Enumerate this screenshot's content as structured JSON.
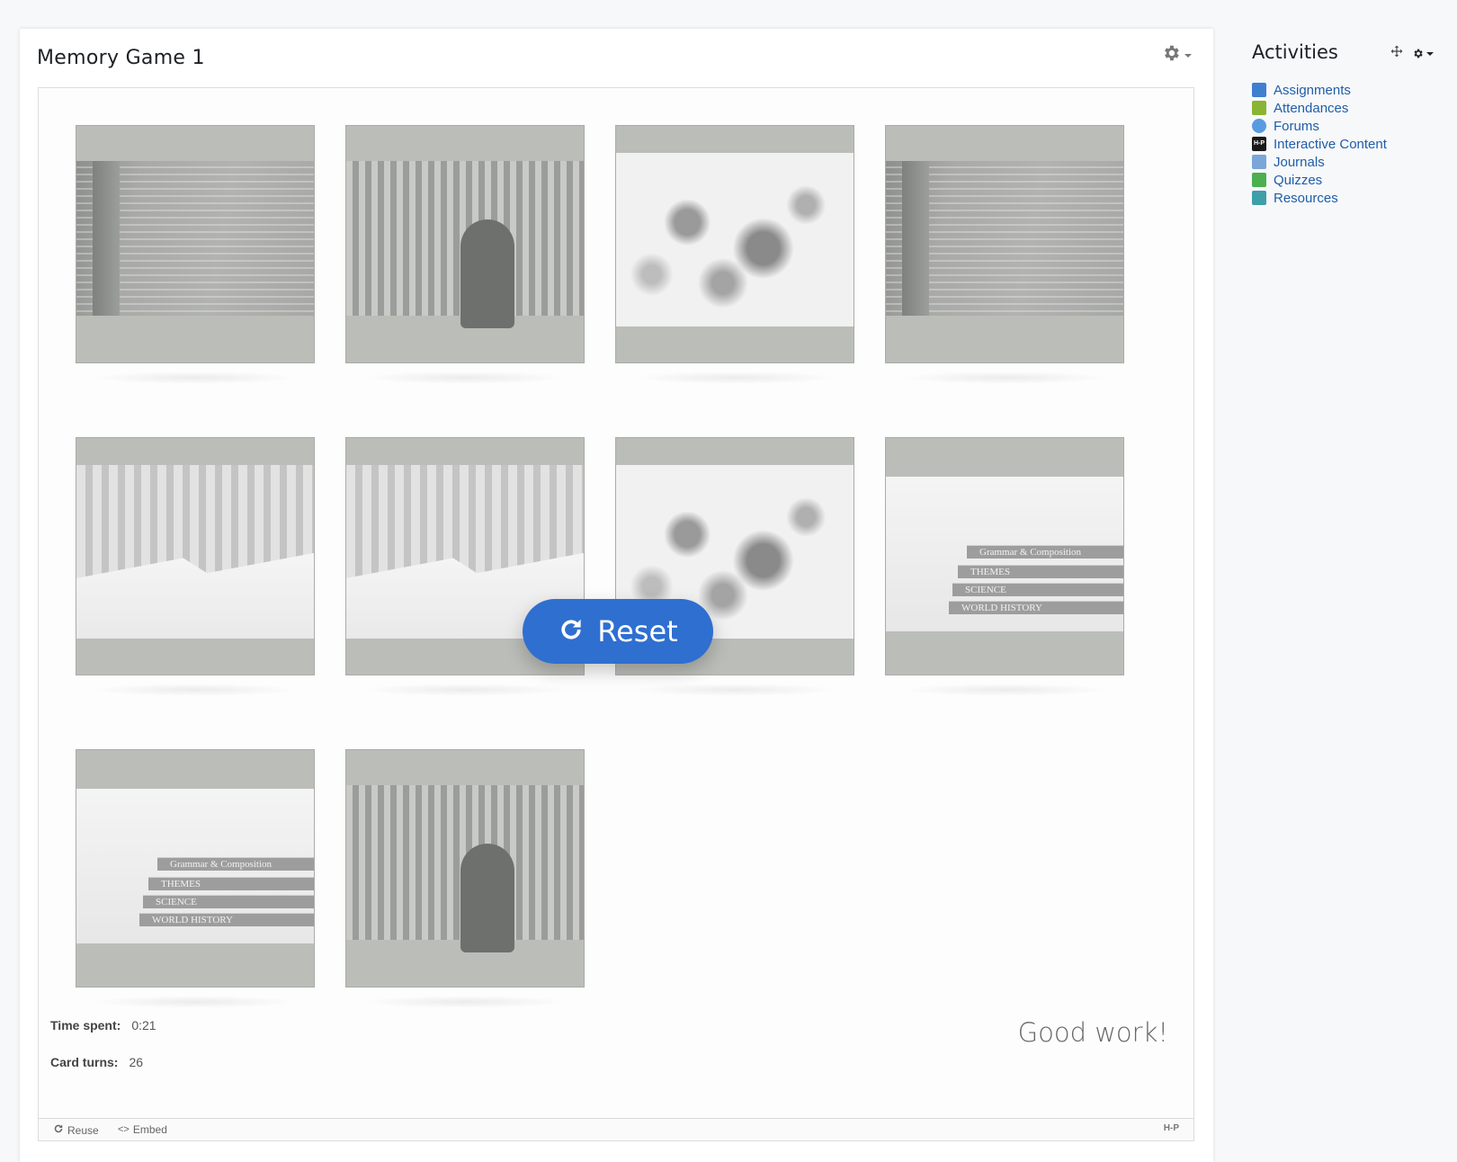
{
  "card_block": {
    "title": "Memory Game 1",
    "gear_icon": "gear-icon"
  },
  "game": {
    "cards": [
      {
        "image": "code-screen"
      },
      {
        "image": "person-behind-blinds"
      },
      {
        "image": "abstract-ink-painting"
      },
      {
        "image": "code-screen"
      },
      {
        "image": "open-books"
      },
      {
        "image": "open-books"
      },
      {
        "image": "abstract-ink-painting"
      },
      {
        "image": "book-stack"
      },
      {
        "image": "book-stack"
      },
      {
        "image": "person-behind-blinds"
      }
    ],
    "book_spines": [
      "Grammar & Composition",
      "THEMES",
      "SCIENCE",
      "WORLD HISTORY"
    ],
    "reset_label": "Reset",
    "reset_icon": "refresh-icon",
    "time_spent_label": "Time spent:",
    "time_spent_value": "0:21",
    "card_turns_label": "Card turns:",
    "card_turns_value": "26",
    "feedback": "Good work!"
  },
  "h5p_actions": {
    "reuse_label": "Reuse",
    "embed_label": "Embed",
    "logo": "H-P"
  },
  "sidebar": {
    "title": "Activities",
    "items": [
      {
        "label": "Assignments",
        "icon": "assignment-icon",
        "color": "#3e7fcf"
      },
      {
        "label": "Attendances",
        "icon": "attendance-icon",
        "color": "#8ab433"
      },
      {
        "label": "Forums",
        "icon": "forum-icon",
        "color": "#5a9be0"
      },
      {
        "label": "Interactive Content",
        "icon": "h5p-icon",
        "color": "#1a1a1a"
      },
      {
        "label": "Journals",
        "icon": "journal-icon",
        "color": "#7aa6d8"
      },
      {
        "label": "Quizzes",
        "icon": "quiz-icon",
        "color": "#4caf50"
      },
      {
        "label": "Resources",
        "icon": "resource-icon",
        "color": "#3f9fa8"
      }
    ]
  },
  "colors": {
    "accent": "#2f6fd0",
    "link": "#1f5da8",
    "card_back": "#bbbdb8"
  }
}
